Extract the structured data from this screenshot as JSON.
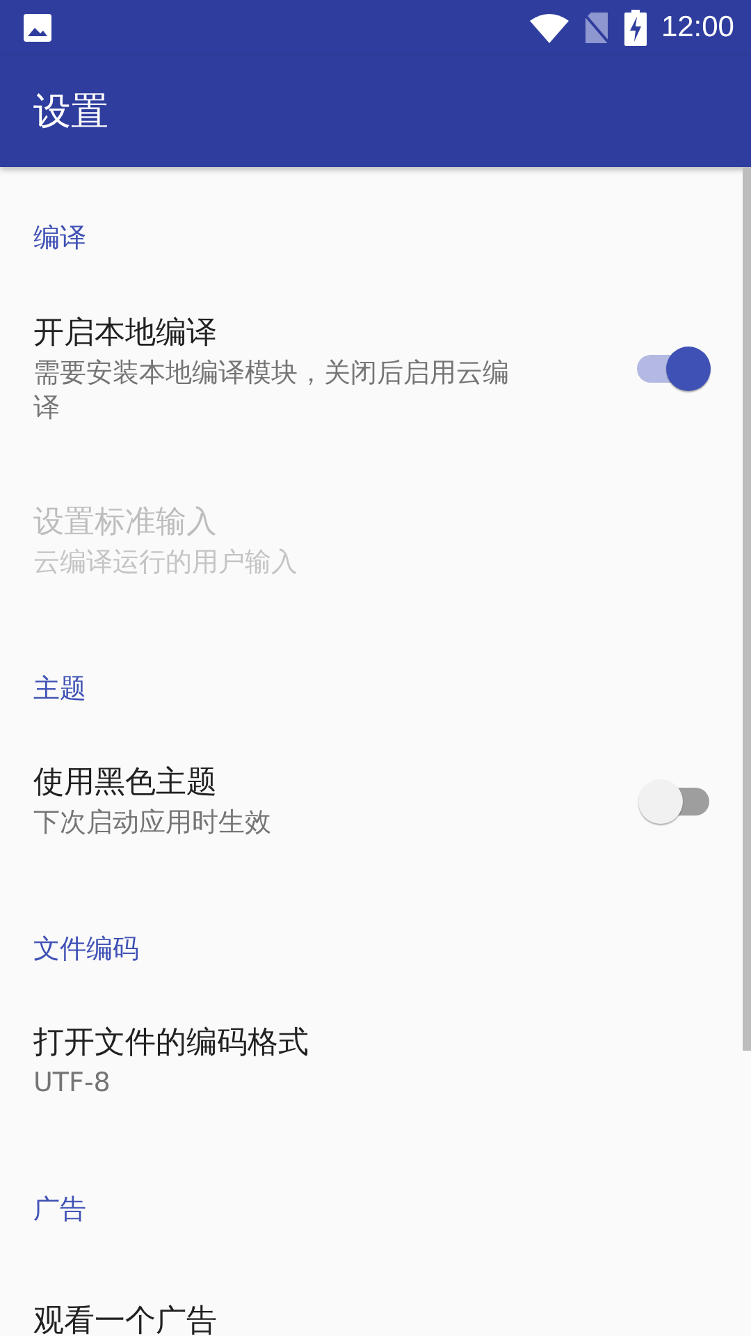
{
  "status_bar": {
    "time": "12:00"
  },
  "app_bar": {
    "title": "设置"
  },
  "sections": [
    {
      "title": "编译",
      "items": [
        {
          "kind": "switch",
          "title": "开启本地编译",
          "summary": "需要安装本地编译模块，关闭后启用云编译",
          "on": true,
          "disabled": false
        },
        {
          "kind": "plain",
          "title": "设置标准输入",
          "summary": "云编译运行的用户输入",
          "disabled": true
        }
      ]
    },
    {
      "title": "主题",
      "items": [
        {
          "kind": "switch",
          "title": "使用黑色主题",
          "summary": "下次启动应用时生效",
          "on": false,
          "disabled": false
        }
      ]
    },
    {
      "title": "文件编码",
      "items": [
        {
          "kind": "plain",
          "title": "打开文件的编码格式",
          "summary": "UTF-8",
          "disabled": false
        }
      ]
    },
    {
      "title": "广告",
      "items": [
        {
          "kind": "plain",
          "title": "观看一个广告",
          "disabled": false
        }
      ]
    }
  ]
}
